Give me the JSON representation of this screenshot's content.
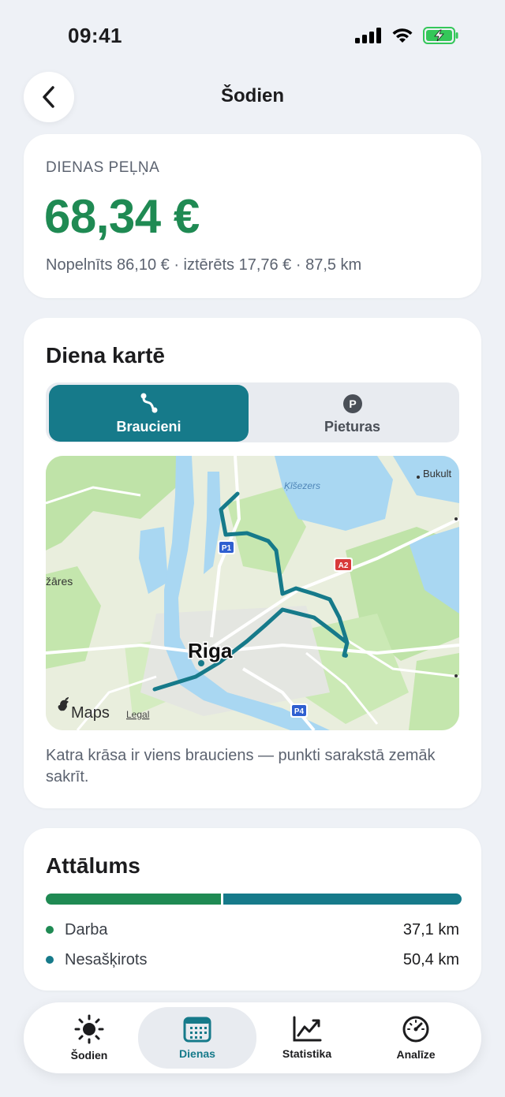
{
  "status_bar": {
    "time": "09:41"
  },
  "header": {
    "title": "Šodien"
  },
  "profit_card": {
    "label": "DIENAS PEĻŅA",
    "value": "68,34 €",
    "summary": "Nopelnīts 86,10 € · iztērēts 17,76 € · 87,5 km"
  },
  "map_card": {
    "title": "Diena kartē",
    "segments": [
      {
        "label": "Braucieni",
        "icon": "route-icon",
        "selected": true
      },
      {
        "label": "Pieturas",
        "icon": "parking-icon",
        "selected": false
      }
    ],
    "map_labels": {
      "city": "Riga",
      "lake": "Ķīšezers",
      "district_left": "žāres",
      "district_right": "Bukult",
      "road_p1": "P1",
      "road_a2": "A2",
      "road_p4": "P4",
      "maps_brand": "Maps",
      "legal": "Legal"
    },
    "caption": "Katra krāsa ir viens brauciens — punkti sarakstā zemāk sakrīt.",
    "route_color": "#167a8a"
  },
  "distance_card": {
    "title": "Attālums",
    "items": [
      {
        "label": "Darba",
        "value": "37,1 km",
        "km": 37.1,
        "color": "#1f8a53"
      },
      {
        "label": "Nesašķirots",
        "value": "50,4 km",
        "km": 50.4,
        "color": "#167a8a"
      }
    ]
  },
  "tab_bar": {
    "tabs": [
      {
        "label": "Šodien",
        "icon": "sun-icon",
        "active": false
      },
      {
        "label": "Dienas",
        "icon": "calendar-icon",
        "active": true
      },
      {
        "label": "Statistika",
        "icon": "chart-icon",
        "active": false
      },
      {
        "label": "Analīze",
        "icon": "gauge-icon",
        "active": false
      }
    ]
  }
}
